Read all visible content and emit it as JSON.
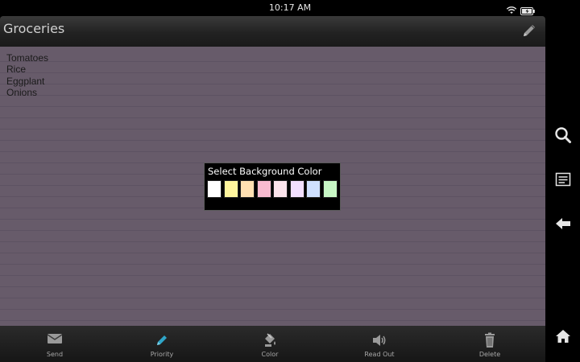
{
  "status_bar": {
    "time": "10:17 AM"
  },
  "note": {
    "title": "Groceries",
    "background_color": "#675b6a",
    "lines": [
      "Tomatoes",
      "Rice",
      "Eggplant",
      "Onions"
    ]
  },
  "color_dialog": {
    "title": "Select Background Color",
    "swatches": [
      "#ffffff",
      "#fff59d",
      "#ffe0b2",
      "#f8bbd0",
      "#fce4ec",
      "#f3e0ff",
      "#cfe0ff",
      "#c8f7c5"
    ]
  },
  "toolbar": {
    "items": [
      {
        "label": "Send",
        "icon": "envelope-icon"
      },
      {
        "label": "Priority",
        "icon": "pencil-icon"
      },
      {
        "label": "Color",
        "icon": "paint-bucket-icon"
      },
      {
        "label": "Read Out",
        "icon": "speaker-icon"
      },
      {
        "label": "Delete",
        "icon": "trash-icon"
      }
    ]
  },
  "sidebar": {
    "items": [
      "search-icon",
      "menu-icon",
      "back-icon",
      "home-icon"
    ]
  }
}
